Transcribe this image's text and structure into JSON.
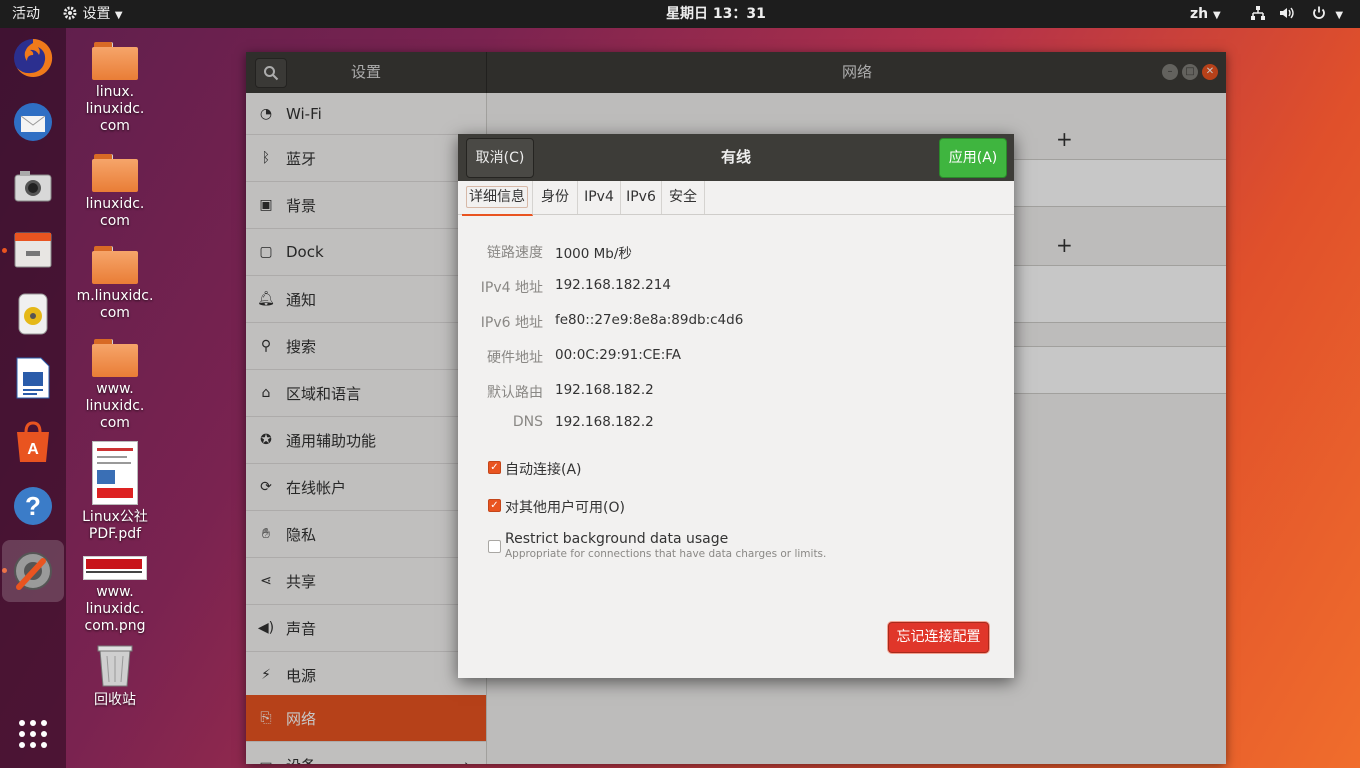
{
  "topbar": {
    "activities": "活动",
    "app_menu": "设置",
    "clock": "星期日 13：31",
    "lang": "zh"
  },
  "dock": {
    "items": [
      "firefox-icon",
      "thunderbird-icon",
      "camera-icon",
      "files-icon",
      "rhythmbox-icon",
      "writer-icon",
      "software-icon",
      "help-icon",
      "settings-icon"
    ],
    "show_apps": "show-apps-icon"
  },
  "desktop": {
    "icons": [
      {
        "name": "linux.\nlinuxidc.\ncom",
        "l1": "linux.",
        "l2": "linuxidc.",
        "l3": "com"
      },
      {
        "l1": "linuxidc.",
        "l2": "com"
      },
      {
        "l1": "m.linuxidc.",
        "l2": "com"
      },
      {
        "l1": "www.",
        "l2": "linuxidc.",
        "l3": "com"
      },
      {
        "l1": "Linux公社",
        "l2": "PDF.pdf"
      },
      {
        "l1": "www.",
        "l2": "linuxidc.",
        "l3": "com.png"
      },
      {
        "l1": "回收站"
      }
    ]
  },
  "settings": {
    "sidebar_title": "设置",
    "panel_title": "网络",
    "sidebar": [
      {
        "label": "Wi-Fi",
        "icon": "wifi-icon"
      },
      {
        "label": "蓝牙",
        "icon": "bluetooth-icon"
      },
      {
        "label": "背景",
        "icon": "background-icon"
      },
      {
        "label": "Dock",
        "icon": "dock-icon"
      },
      {
        "label": "通知",
        "icon": "bell-icon"
      },
      {
        "label": "搜索",
        "icon": "search-icon"
      },
      {
        "label": "区域和语言",
        "icon": "region-icon"
      },
      {
        "label": "通用辅助功能",
        "icon": "accessibility-icon"
      },
      {
        "label": "在线帐户",
        "icon": "online-accounts-icon"
      },
      {
        "label": "隐私",
        "icon": "privacy-icon"
      },
      {
        "label": "共享",
        "icon": "share-icon"
      },
      {
        "label": "声音",
        "icon": "sound-icon"
      },
      {
        "label": "电源",
        "icon": "power-icon"
      },
      {
        "label": "网络",
        "icon": "network-icon",
        "selected": true
      },
      {
        "label": "设备",
        "icon": "devices-icon"
      }
    ]
  },
  "dialog": {
    "title": "有线",
    "cancel": "取消(C)",
    "apply": "应用(A)",
    "tabs": [
      "详细信息",
      "身份",
      "IPv4",
      "IPv6",
      "安全"
    ],
    "details": [
      {
        "label": "链路速度",
        "value": "1000 Mb/秒"
      },
      {
        "label": "IPv4 地址",
        "value": "192.168.182.214"
      },
      {
        "label": "IPv6 地址",
        "value": "fe80::27e9:8e8a:89db:c4d6"
      },
      {
        "label": "硬件地址",
        "value": "00:0C:29:91:CE:FA"
      },
      {
        "label": "默认路由",
        "value": "192.168.182.2"
      },
      {
        "label": "DNS",
        "value": "192.168.182.2"
      }
    ],
    "auto_connect": {
      "label": "自动连接(A)",
      "checked": true
    },
    "all_users": {
      "label": "对其他用户可用(O)",
      "checked": true
    },
    "restrict": {
      "label": "Restrict background data usage",
      "hint": "Appropriate for connections that have data charges or limits.",
      "checked": false
    },
    "forget": "忘记连接配置"
  }
}
